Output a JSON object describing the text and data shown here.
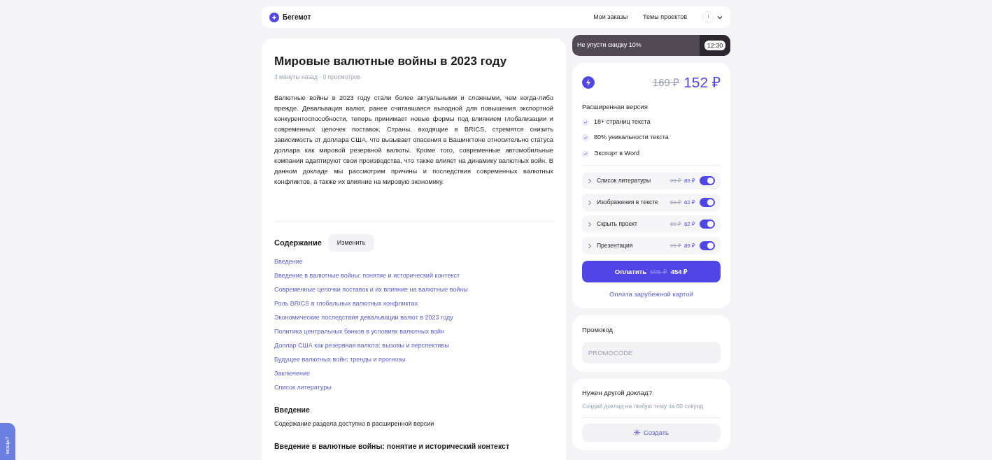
{
  "header": {
    "logo": "Бегемот",
    "nav": [
      "Мои заказы",
      "Темы проектов"
    ],
    "avatar": "I"
  },
  "article": {
    "title": "Мировые валютные войны в 2023 году",
    "meta": "3 минуты назад · 0 просмотров",
    "body": "Валютные войны в 2023 году стали более актуальными и сложными, чем когда-либо прежде. Девальвация валют, ранее считавшаяся выгодной для повышения экспортной конкурентоспособности, теперь принимает новые формы под влиянием глобализации и современных цепочек поставок. Страны, входящие в BRICS, стремятся снизить зависимость от доллара США, что вызывает опасения в Вашингтоне относительно статуса доллара как мировой резервной валюты. Кроме того, современные автомобильные компании адаптируют свои производства, что также влияет на динамику валютных войн. В данном докладе мы рассмотрим причины и последствия современных валютных конфликтов, а также их влияние на мировую экономику.",
    "contents_title": "Содержание",
    "edit_button": "Изменить",
    "contents": [
      "Введение",
      "Введение в валютные войны: понятие и исторический контекст",
      "Современные цепочки поставок и их влияние на валютные войны",
      "Роль BRICS в глобальных валютных конфликтах",
      "Экономические последствия девальвации валют в 2023 году",
      "Политика центральных банков в условиях валютных войн",
      "Доллар США как резервная валюта: вызовы и перспективы",
      "Будущее валютных войн: тренды и прогнозы",
      "Заключение",
      "Список литературы"
    ],
    "sections": [
      {
        "title": "Введение",
        "text": "Содержание раздела доступно в расширенной версии"
      },
      {
        "title": "Введение в валютные войны: понятие и исторический контекст"
      }
    ]
  },
  "promo_banner": {
    "text": "Не упусти скидку 10%",
    "timer": "12:30"
  },
  "offer": {
    "old_price": "169 ₽",
    "price": "152 ₽",
    "plan": "Расширенная версия",
    "features": [
      "18+ страниц текста",
      "80% уникальности текста",
      "Экспорт в Word"
    ],
    "options": [
      {
        "label": "Список литературы",
        "old_price": "99 ₽",
        "price": "89 ₽",
        "on": true
      },
      {
        "label": "Изображения в тексте",
        "old_price": "69 ₽",
        "price": "62 ₽",
        "on": true
      },
      {
        "label": "Скрыть проект",
        "old_price": "69 ₽",
        "price": "62 ₽",
        "on": true
      },
      {
        "label": "Презентация",
        "old_price": "99 ₽",
        "price": "89 ₽",
        "on": true
      }
    ],
    "pay_button": {
      "label": "Оплатить",
      "old_price": "505 ₽",
      "price": "454 ₽"
    },
    "foreign_card_link": "Оплата зарубежной картой"
  },
  "promocode": {
    "title": "Промокод",
    "placeholder": "PROMOCODE"
  },
  "create_card": {
    "title": "Нужен другой доклад?",
    "subtitle": "Создай доклад на любую тему за 60 секунд",
    "button": "Создать"
  },
  "help_tab": "мощь?"
}
